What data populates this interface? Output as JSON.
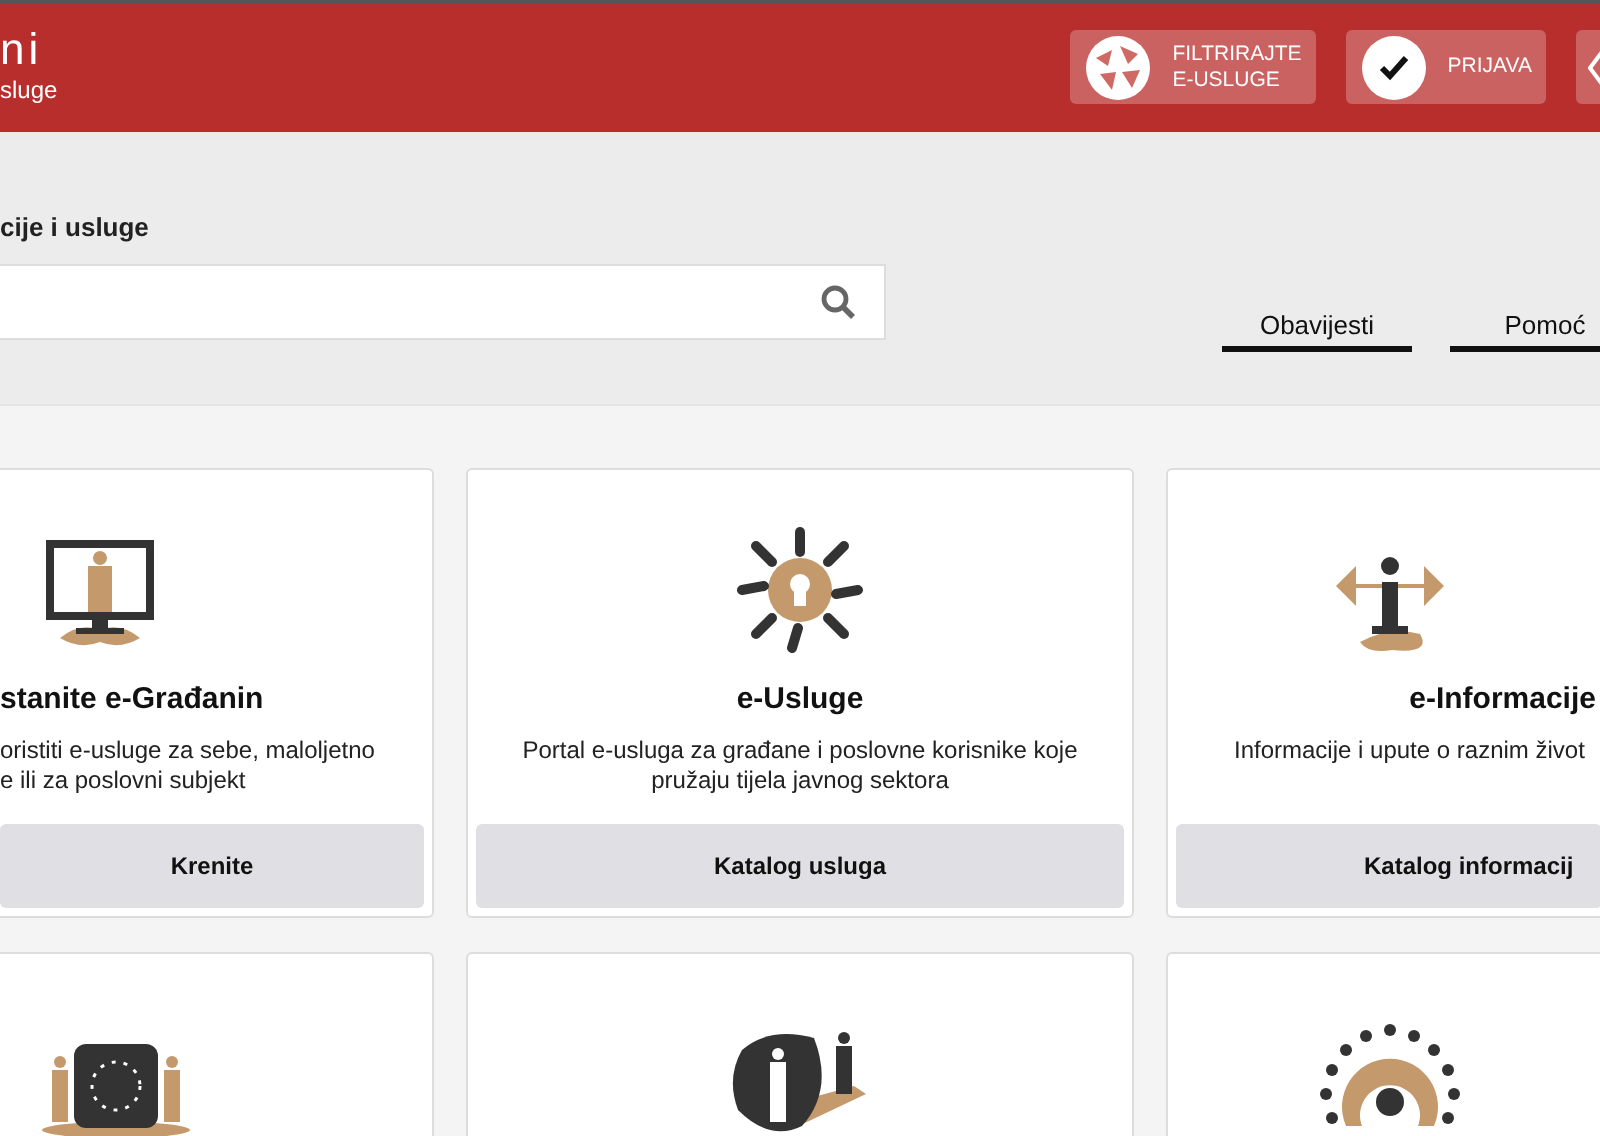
{
  "header": {
    "title": "ni",
    "subtitle": "sluge",
    "buttons": [
      {
        "kind": "filter",
        "lines": [
          "FILTRIRAJTE",
          "E-USLUGE"
        ]
      },
      {
        "kind": "login",
        "lines": [
          "PRIJAVA"
        ]
      },
      {
        "kind": "icon"
      }
    ]
  },
  "search": {
    "label": "cije i usluge"
  },
  "tabs": [
    {
      "label": "Obavijesti"
    },
    {
      "label": "Pomoć"
    }
  ],
  "cards": [
    {
      "kind": "full",
      "title": "stanite e-Građanin",
      "description": "oristiti e-usluge za sebe, maloljetno\ne ili za poslovni subjekt",
      "button": "Krenite"
    },
    {
      "kind": "full",
      "title": "e-Usluge",
      "description": "Portal e-usluga za građane i poslovne korisnike koje pružaju tijela javnog sektora",
      "button": "Katalog usluga"
    },
    {
      "kind": "full",
      "title": "e-Informacije",
      "description": "Informacije i upute o raznim život",
      "button": "Katalog informacij"
    },
    {
      "kind": "icon"
    },
    {
      "kind": "icon"
    },
    {
      "kind": "icon"
    }
  ]
}
